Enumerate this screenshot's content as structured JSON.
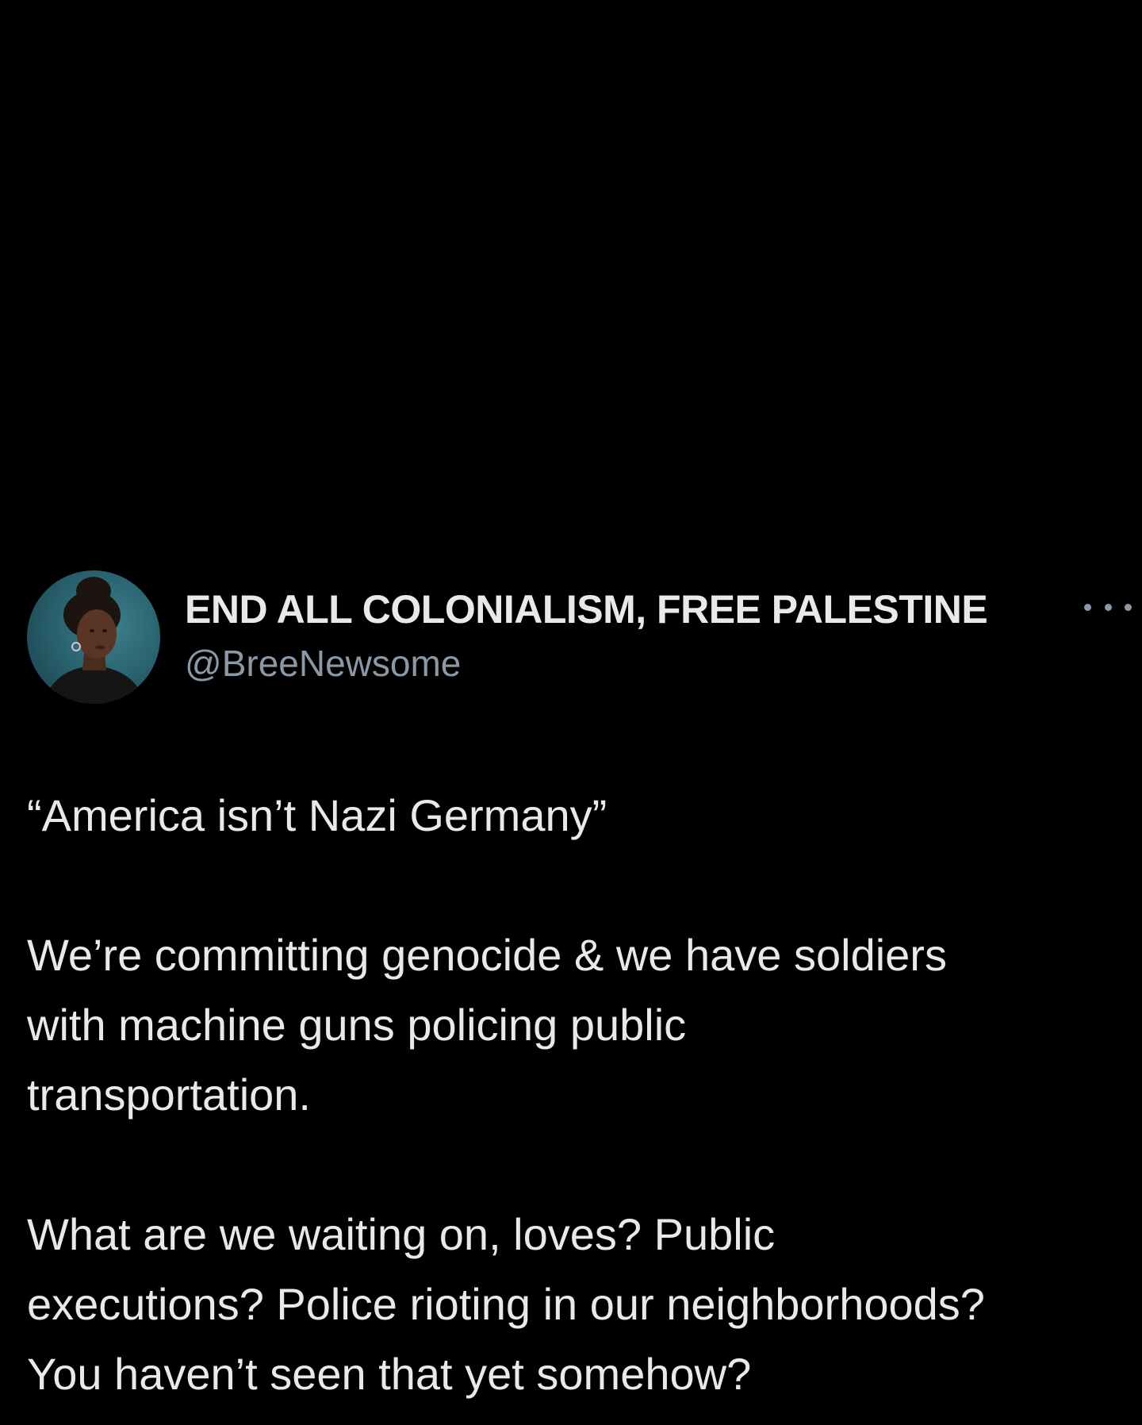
{
  "tweet": {
    "author": {
      "display_name": "END ALL COLONIALISM, FREE PALESTINE",
      "handle": "@BreeNewsome",
      "avatar_icon": "profile-photo"
    },
    "more_icon": "more-options-icon",
    "body": {
      "paragraph_1": "“America isn’t Nazi Germany”",
      "paragraph_2": "We’re committing genocide & we have soldiers\nwith machine guns policing public\ntransportation.",
      "paragraph_3": "What are we waiting on, loves? Public\nexecutions? Police rioting in our neighborhoods?\nYou haven’t seen that yet somehow?"
    },
    "colors": {
      "background": "#000000",
      "text_primary": "#e7e9ea",
      "text_secondary": "#8b98a5",
      "avatar_background": "#2a6470"
    }
  }
}
